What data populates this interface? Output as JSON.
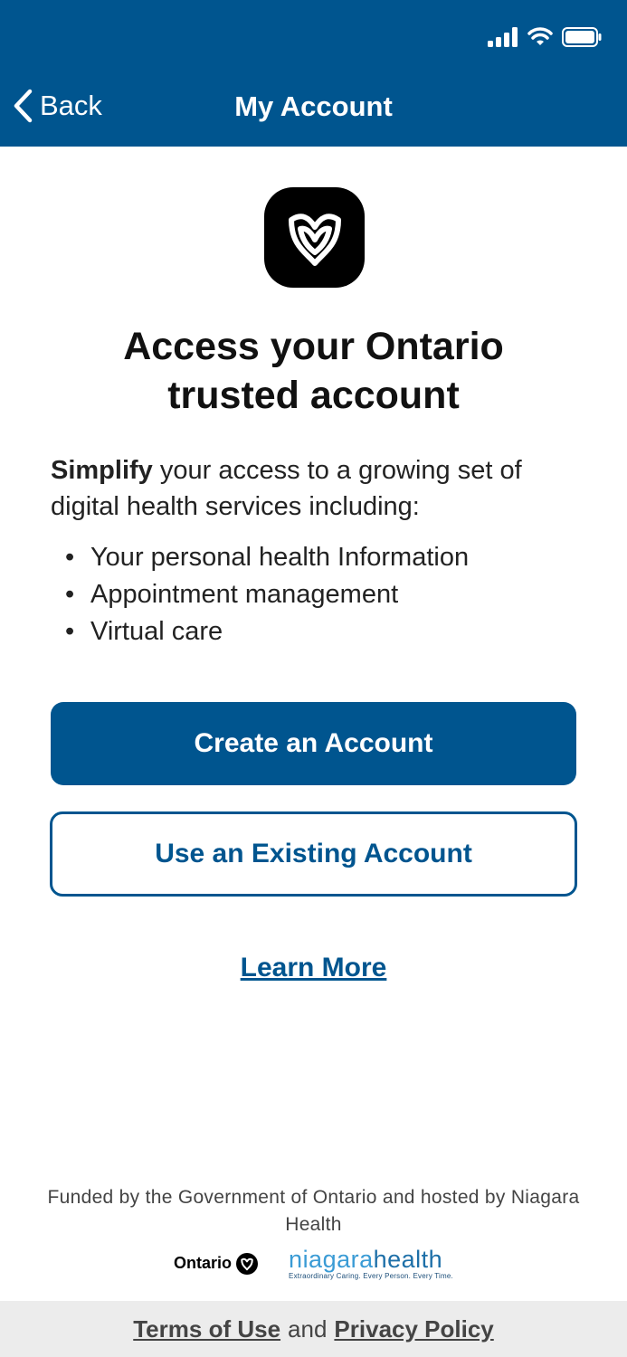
{
  "colors": {
    "primary": "#00558f",
    "white": "#ffffff",
    "footer_bg": "#ececec"
  },
  "status_bar": {
    "icons": [
      "signal-icon",
      "wifi-icon",
      "battery-icon"
    ]
  },
  "nav": {
    "back_label": "Back",
    "title": "My Account"
  },
  "logo": {
    "icon": "trillium-icon"
  },
  "title_line1": "Access your Ontario",
  "title_line2": "trusted account",
  "intro": {
    "bold": "Simplify",
    "rest": " your access to a growing set of digital health services including:"
  },
  "bullets": [
    "Your personal health Information",
    "Appointment management",
    "Virtual care"
  ],
  "buttons": {
    "create": "Create an Account",
    "existing": "Use an Existing Account"
  },
  "learn_more": "Learn More",
  "funded_text": "Funded by the Government of Ontario and hosted by Niagara Health",
  "partner_logos": {
    "ontario": "Ontario",
    "niagara_word_a": "niagara",
    "niagara_word_b": "health",
    "niagara_tagline": "Extraordinary Caring. Every Person. Every Time."
  },
  "footer": {
    "terms": "Terms of Use",
    "and": "and",
    "privacy": "Privacy Policy"
  }
}
